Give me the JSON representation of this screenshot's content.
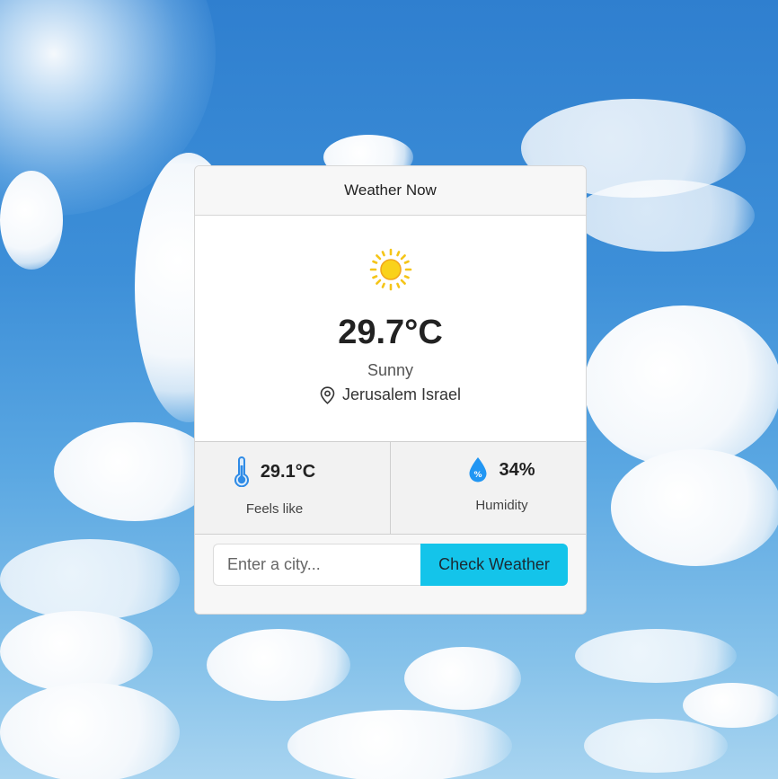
{
  "card": {
    "title": "Weather Now",
    "temperature": "29.7°C",
    "condition": "Sunny",
    "location": "Jerusalem Israel"
  },
  "stats": {
    "feels_like": {
      "value": "29.1°C",
      "label": "Feels like",
      "icon": "thermometer-icon"
    },
    "humidity": {
      "value": "34%",
      "label": "Humidity",
      "icon": "humidity-drop-icon"
    }
  },
  "form": {
    "placeholder": "Enter a city...",
    "button_label": "Check Weather"
  },
  "colors": {
    "button": "#14c4ea",
    "sun": "#f5c518",
    "icon_blue": "#2f8be6"
  }
}
